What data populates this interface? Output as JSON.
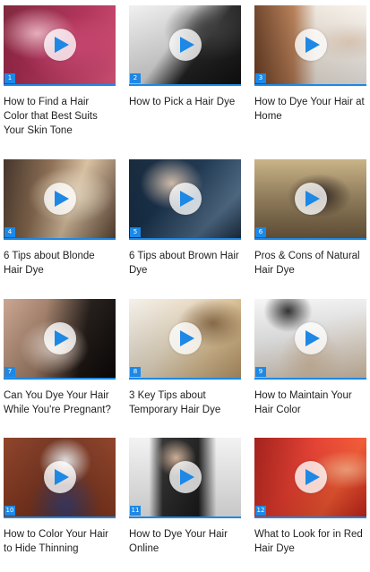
{
  "videos": [
    {
      "number": "1",
      "title": "How to Find a Hair Color that Best Suits Your Skin Tone",
      "thumb_colors": [
        "#d84878",
        "#7a1d34",
        "#f3b7c6"
      ]
    },
    {
      "number": "2",
      "title": "How to Pick a Hair Dye",
      "thumb_colors": [
        "#e7e7e7",
        "#1c1c1c",
        "#a3a3a3"
      ]
    },
    {
      "number": "3",
      "title": "How to Dye Your Hair at Home",
      "thumb_colors": [
        "#b47a52",
        "#efe7dd",
        "#7b4b2d"
      ]
    },
    {
      "number": "4",
      "title": "6 Tips about Blonde Hair Dye",
      "thumb_colors": [
        "#8a6b4f",
        "#efdfc6",
        "#3a2a20"
      ]
    },
    {
      "number": "5",
      "title": "6 Tips about Brown Hair Dye",
      "thumb_colors": [
        "#16304a",
        "#4e6b87",
        "#d8c2b0"
      ]
    },
    {
      "number": "6",
      "title": "Pros & Cons of Natural Hair Dye",
      "thumb_colors": [
        "#6f5a3f",
        "#c7b082",
        "#2a1f1b"
      ]
    },
    {
      "number": "7",
      "title": "Can You Dye Your Hair While You're Pregnant?",
      "thumb_colors": [
        "#1c1512",
        "#c8a38c",
        "#f0ddd0"
      ]
    },
    {
      "number": "8",
      "title": "3 Key Tips about Temporary Hair Dye",
      "thumb_colors": [
        "#f4f0ea",
        "#d6bb8e",
        "#8a6a45"
      ]
    },
    {
      "number": "9",
      "title": "How to Maintain Your Hair Color",
      "thumb_colors": [
        "#f5f5f5",
        "#d7c2a8",
        "#2a2a2a"
      ]
    },
    {
      "number": "10",
      "title": "How to Color Your Hair to Hide Thinning",
      "thumb_colors": [
        "#8a3b21",
        "#f2f2f2",
        "#3d3d6a"
      ]
    },
    {
      "number": "11",
      "title": "How to Dye Your Hair Online",
      "thumb_colors": [
        "#f2f2f2",
        "#2d2d2d",
        "#d4b39b"
      ]
    },
    {
      "number": "12",
      "title": "What to Look for in Red Hair Dye",
      "thumb_colors": [
        "#e53a2c",
        "#9e1712",
        "#fba07a"
      ]
    }
  ],
  "colors": {
    "accent": "#1e88e5",
    "title_text": "#1f1f1f",
    "background": "#ffffff"
  },
  "icons": {
    "play": "play-icon"
  }
}
